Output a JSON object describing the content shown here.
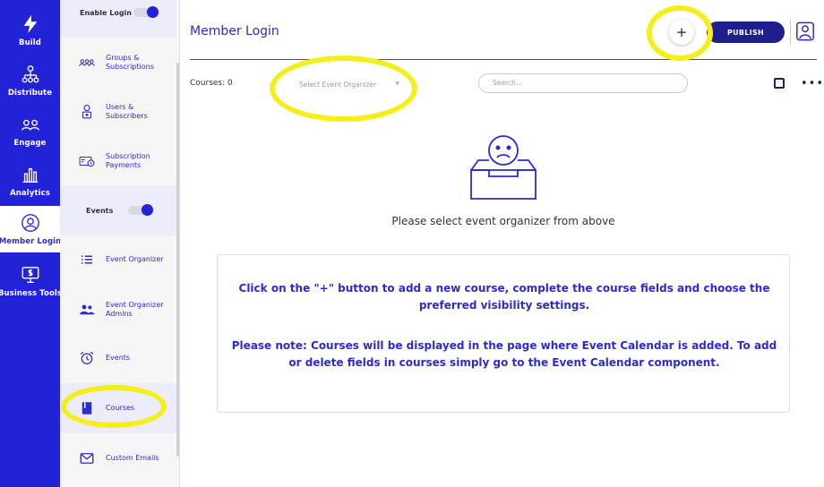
{
  "rail": {
    "items": [
      {
        "label": "Build",
        "icon": "lightning-icon"
      },
      {
        "label": "Distribute",
        "icon": "network-icon"
      },
      {
        "label": "Engage",
        "icon": "people-icon"
      },
      {
        "label": "Analytics",
        "icon": "bar-chart-icon"
      },
      {
        "label": "Member Login",
        "icon": "user-circle-icon"
      },
      {
        "label": "Business Tools",
        "icon": "monitor-dollar-icon"
      }
    ]
  },
  "panel": {
    "enable_login_label": "Enable Login",
    "events_label": "Events",
    "items": [
      {
        "label": "Groups & Subscriptions",
        "icon": "group-icon"
      },
      {
        "label": "Users & Subscribers",
        "icon": "lock-user-icon"
      },
      {
        "label": "Subscription Payments",
        "icon": "payment-icon"
      },
      {
        "label": "Event Organizer",
        "icon": "list-icon"
      },
      {
        "label": "Event Organizer Admins",
        "icon": "admins-icon"
      },
      {
        "label": "Events",
        "icon": "alarm-icon"
      },
      {
        "label": "Courses",
        "icon": "book-icon"
      },
      {
        "label": "Custom Emails",
        "icon": "mail-icon"
      }
    ]
  },
  "header": {
    "title": "Member Login",
    "add_label": "+",
    "publish_label": "PUBLISH"
  },
  "toolbar": {
    "count_label": "Courses: 0",
    "select_placeholder": "Select Event Organizer",
    "search_placeholder": "Search..."
  },
  "empty_state": {
    "message": "Please select event organizer from above"
  },
  "info": {
    "line1": "Click on the \"+\" button to add a new course, complete the course fields and choose the preferred visibility settings.",
    "line2": "Please note: Courses will be displayed in the page where Event Calendar is added. To add or delete fields in courses simply go to the Event Calendar component."
  },
  "colors": {
    "rail_bg": "#2222d6",
    "accent": "#2b2bd0",
    "publish_bg": "#1e1e8c",
    "highlight": "#f3ef1e"
  }
}
